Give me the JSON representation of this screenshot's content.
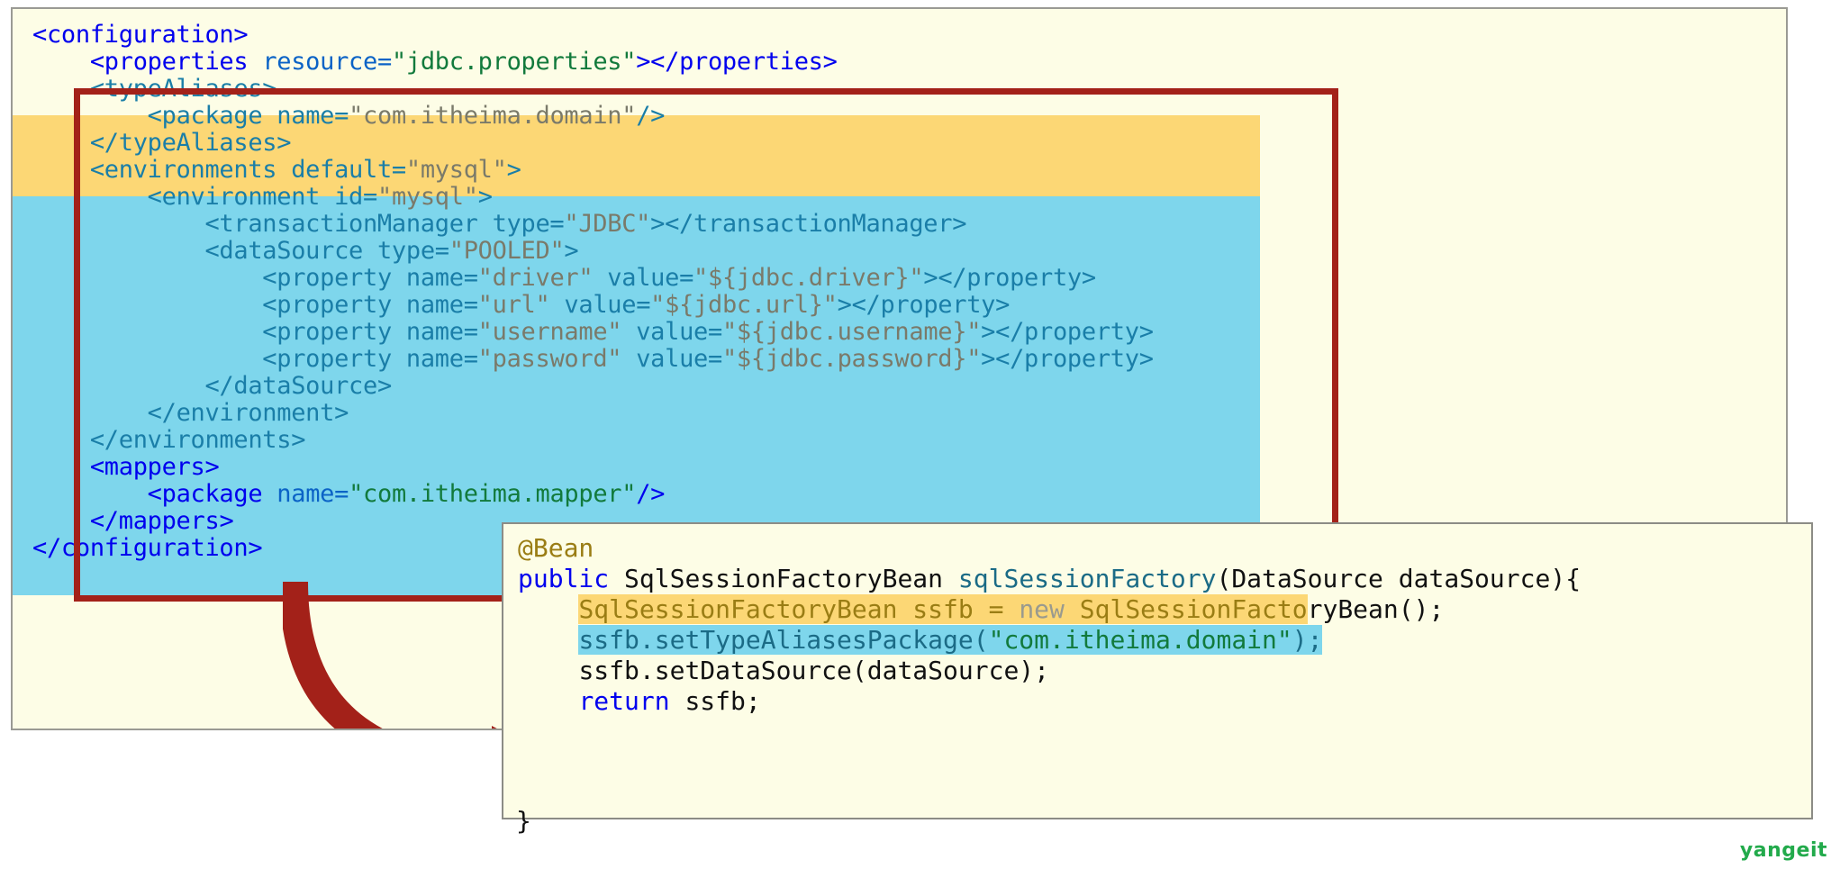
{
  "xml_panel": {
    "lines": [
      {
        "indent": 0,
        "text": "<configuration>"
      },
      {
        "indent": 1,
        "text": "<properties resource=\"jdbc.properties\"></properties>"
      },
      {
        "indent": 1,
        "text": "<typeAliases>",
        "highlight": "yellow"
      },
      {
        "indent": 2,
        "text": "<package name=\"com.itheima.domain\"/>",
        "highlight": "yellow"
      },
      {
        "indent": 1,
        "text": "</typeAliases>",
        "highlight": "yellow"
      },
      {
        "indent": 1,
        "text": "<environments default=\"mysql\">",
        "highlight": "blue"
      },
      {
        "indent": 2,
        "text": "<environment id=\"mysql\">",
        "highlight": "blue"
      },
      {
        "indent": 3,
        "text": "<transactionManager type=\"JDBC\"></transactionManager>",
        "highlight": "blue"
      },
      {
        "indent": 3,
        "text": "<dataSource type=\"POOLED\">",
        "highlight": "blue"
      },
      {
        "indent": 4,
        "text": "<property name=\"driver\" value=\"${jdbc.driver}\"></property>",
        "highlight": "blue"
      },
      {
        "indent": 4,
        "text": "<property name=\"url\" value=\"${jdbc.url}\"></property>",
        "highlight": "blue"
      },
      {
        "indent": 4,
        "text": "<property name=\"username\" value=\"${jdbc.username}\"></property>",
        "highlight": "blue"
      },
      {
        "indent": 4,
        "text": "<property name=\"password\" value=\"${jdbc.password}\"></property>",
        "highlight": "blue"
      },
      {
        "indent": 3,
        "text": "</dataSource>",
        "highlight": "blue"
      },
      {
        "indent": 2,
        "text": "</environment>",
        "highlight": "blue"
      },
      {
        "indent": 1,
        "text": "</environments>",
        "highlight": "blue"
      },
      {
        "indent": 1,
        "text": "<mappers>"
      },
      {
        "indent": 2,
        "text": "<package name=\"com.itheima.mapper\"/>"
      },
      {
        "indent": 1,
        "text": "</mappers>"
      },
      {
        "indent": 0,
        "text": "</configuration>"
      }
    ]
  },
  "java_panel": {
    "lines": [
      {
        "text": "@Bean",
        "style": "annotation"
      },
      {
        "text": "public SqlSessionFactoryBean sqlSessionFactory(DataSource dataSource){",
        "style": "signature"
      },
      {
        "text": "SqlSessionFactoryBean ssfb = new SqlSessionFactoryBean();",
        "style": "highlight-yellow"
      },
      {
        "text": "ssfb.setTypeAliasesPackage(\"com.itheima.domain\");",
        "style": "highlight-blue"
      },
      {
        "text": "ssfb.setDataSource(dataSource);",
        "style": "plain"
      },
      {
        "text": "return ssfb;",
        "style": "keyword-return"
      }
    ],
    "closing_brace": "}"
  },
  "annotations": {
    "red_box_label": "typeAliases-and-environments-highlighted",
    "arrow_label": "xml-to-java-mapping-arrow"
  },
  "colors": {
    "panel_background": "#fdfde6",
    "panel_border": "#9a9a94",
    "red_box": "#a32119",
    "highlight_yellow": "#fcd775",
    "highlight_blue": "#7ed6ec",
    "tag_blue": "#0000ee",
    "attr_blue": "#0b63c6",
    "value_green": "#127a3c",
    "watermark_green": "#22aa4b"
  },
  "watermark": {
    "text": "yangeit"
  }
}
